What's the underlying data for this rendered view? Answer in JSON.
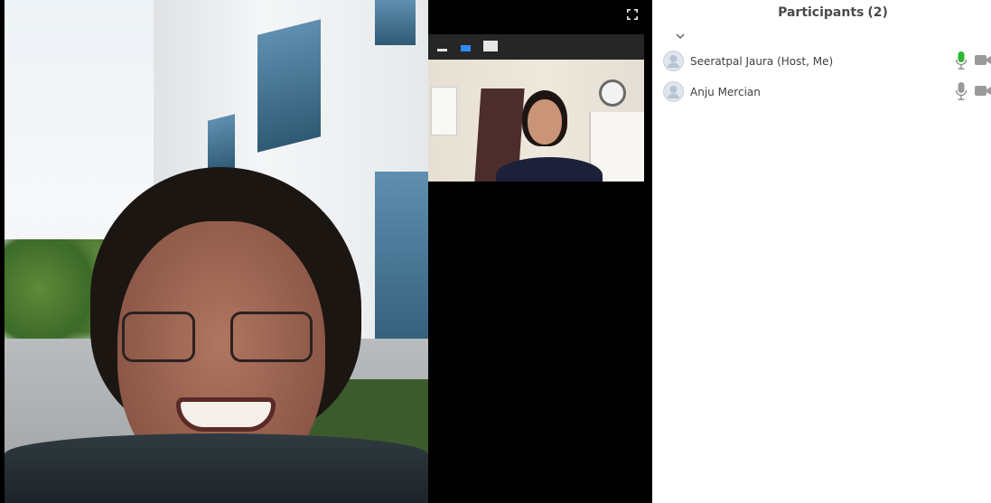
{
  "main_video": {
    "description": "Active speaker video"
  },
  "gallery": {
    "fullscreen_icon": "expand-icon",
    "toolbar": {
      "minimize_icon": "minimize-icon",
      "single_view_icon": "single-view-icon",
      "gallery_view_icon": "gallery-view-icon"
    }
  },
  "participants": {
    "title": "Participants",
    "count": "(2)",
    "collapse_icon": "chevron-down-icon",
    "list": [
      {
        "name": "Seeratpal Jaura (Host, Me)",
        "mic": "on",
        "mic_color": "#2eb82e",
        "video": "off"
      },
      {
        "name": "Anju Mercian",
        "mic": "muted",
        "mic_color": "#9a9a9a",
        "video": "off"
      }
    ]
  },
  "colors": {
    "accent": "#2d8cff",
    "mic_active": "#2eb82e",
    "icon_gray": "#9a9a9a",
    "panel_title": "#4a4a4a"
  }
}
